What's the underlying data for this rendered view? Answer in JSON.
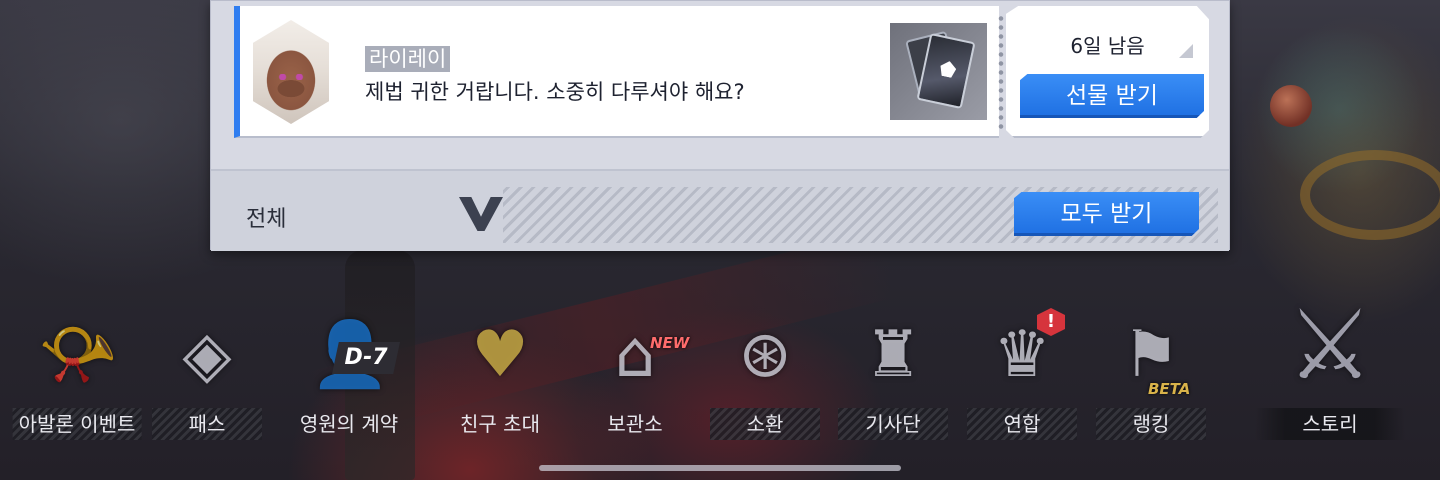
{
  "gift": {
    "sender": "라이레이",
    "message": "제법 귀한 거랍니다. 소중히 다루셔야 해요?",
    "days_left": "6일 남음",
    "receive_label": "선물 받기"
  },
  "footer": {
    "filter_label": "전체",
    "receive_all_label": "모두 받기"
  },
  "nav": {
    "items": [
      {
        "label": "아발론 이벤트",
        "icon": "horn-icon",
        "glyph": "📯"
      },
      {
        "label": "패스",
        "icon": "diamond-star-icon",
        "glyph": "◈"
      },
      {
        "label": "영원의 계약",
        "icon": "character-portrait-icon",
        "glyph": "👤",
        "badge": "D-7"
      },
      {
        "label": "친구 초대",
        "icon": "heart-hand-icon",
        "glyph": "♥"
      },
      {
        "label": "보관소",
        "icon": "storage-house-icon",
        "glyph": "⌂",
        "badge": "NEW"
      },
      {
        "label": "소환",
        "icon": "compass-watch-icon",
        "glyph": "⊛"
      },
      {
        "label": "기사단",
        "icon": "order-emblem-icon",
        "glyph": "♜"
      },
      {
        "label": "연합",
        "icon": "alliance-banner-icon",
        "glyph": "♛",
        "badge": "!"
      },
      {
        "label": "랭킹",
        "icon": "ranking-banner-icon",
        "glyph": "⚑",
        "badge": "BETA"
      },
      {
        "label": "스토리",
        "icon": "sword-emblem-icon",
        "glyph": "⚔"
      }
    ]
  },
  "colors": {
    "accent_blue": "#2f7df0",
    "panel_bg": "#d7d9e3",
    "alert_red": "#d6343c",
    "new_badge": "#ff6c6c",
    "beta_badge": "#d9b34a"
  }
}
